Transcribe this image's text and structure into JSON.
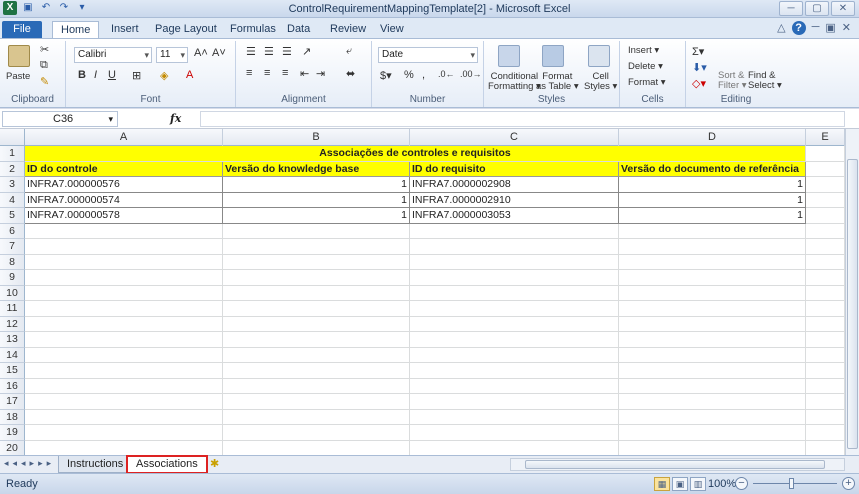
{
  "window": {
    "title": "ControlRequirementMappingTemplate[2]  -  Microsoft Excel"
  },
  "ribbon_tabs": [
    "File",
    "Home",
    "Insert",
    "Page Layout",
    "Formulas",
    "Data",
    "Review",
    "View"
  ],
  "ribbon": {
    "clipboard": {
      "paste": "Paste",
      "label": "Clipboard"
    },
    "font": {
      "name": "Calibri",
      "size": "11",
      "label": "Font"
    },
    "alignment": {
      "label": "Alignment"
    },
    "number": {
      "format": "Date",
      "label": "Number"
    },
    "styles": {
      "conditional": "Conditional\nFormatting ▾",
      "format_table": "Format\nas Table ▾",
      "cell_styles": "Cell\nStyles ▾",
      "label": "Styles"
    },
    "cells": {
      "insert": "Insert ▾",
      "delete": "Delete ▾",
      "format": "Format ▾",
      "label": "Cells"
    },
    "editing": {
      "sort": "Sort &\nFilter ▾",
      "find": "Find &\nSelect ▾",
      "label": "Editing"
    }
  },
  "formula_bar": {
    "name_box": "C36",
    "fx": "fx",
    "value": ""
  },
  "columns": [
    "A",
    "B",
    "C",
    "D",
    "E"
  ],
  "sheet": {
    "title": "Associações de controles e requisitos",
    "headers": [
      "ID do controle",
      "Versão do knowledge base",
      "ID do requisito",
      "Versão do documento de referência"
    ],
    "rows": [
      [
        "INFRA7.000000576",
        "1",
        "INFRA7.0000002908",
        "1"
      ],
      [
        "INFRA7.000000574",
        "1",
        "INFRA7.0000002910",
        "1"
      ],
      [
        "INFRA7.000000578",
        "1",
        "INFRA7.0000003053",
        "1"
      ]
    ],
    "row_numbers": [
      "1",
      "2",
      "3",
      "4",
      "5",
      "6",
      "7",
      "8",
      "9",
      "10",
      "11",
      "12",
      "13",
      "14",
      "15",
      "16",
      "17",
      "18",
      "19",
      "20"
    ]
  },
  "sheet_tabs": [
    "Instructions",
    "Associations"
  ],
  "active_sheet": "Associations",
  "status": {
    "text": "Ready",
    "zoom": "100%"
  }
}
